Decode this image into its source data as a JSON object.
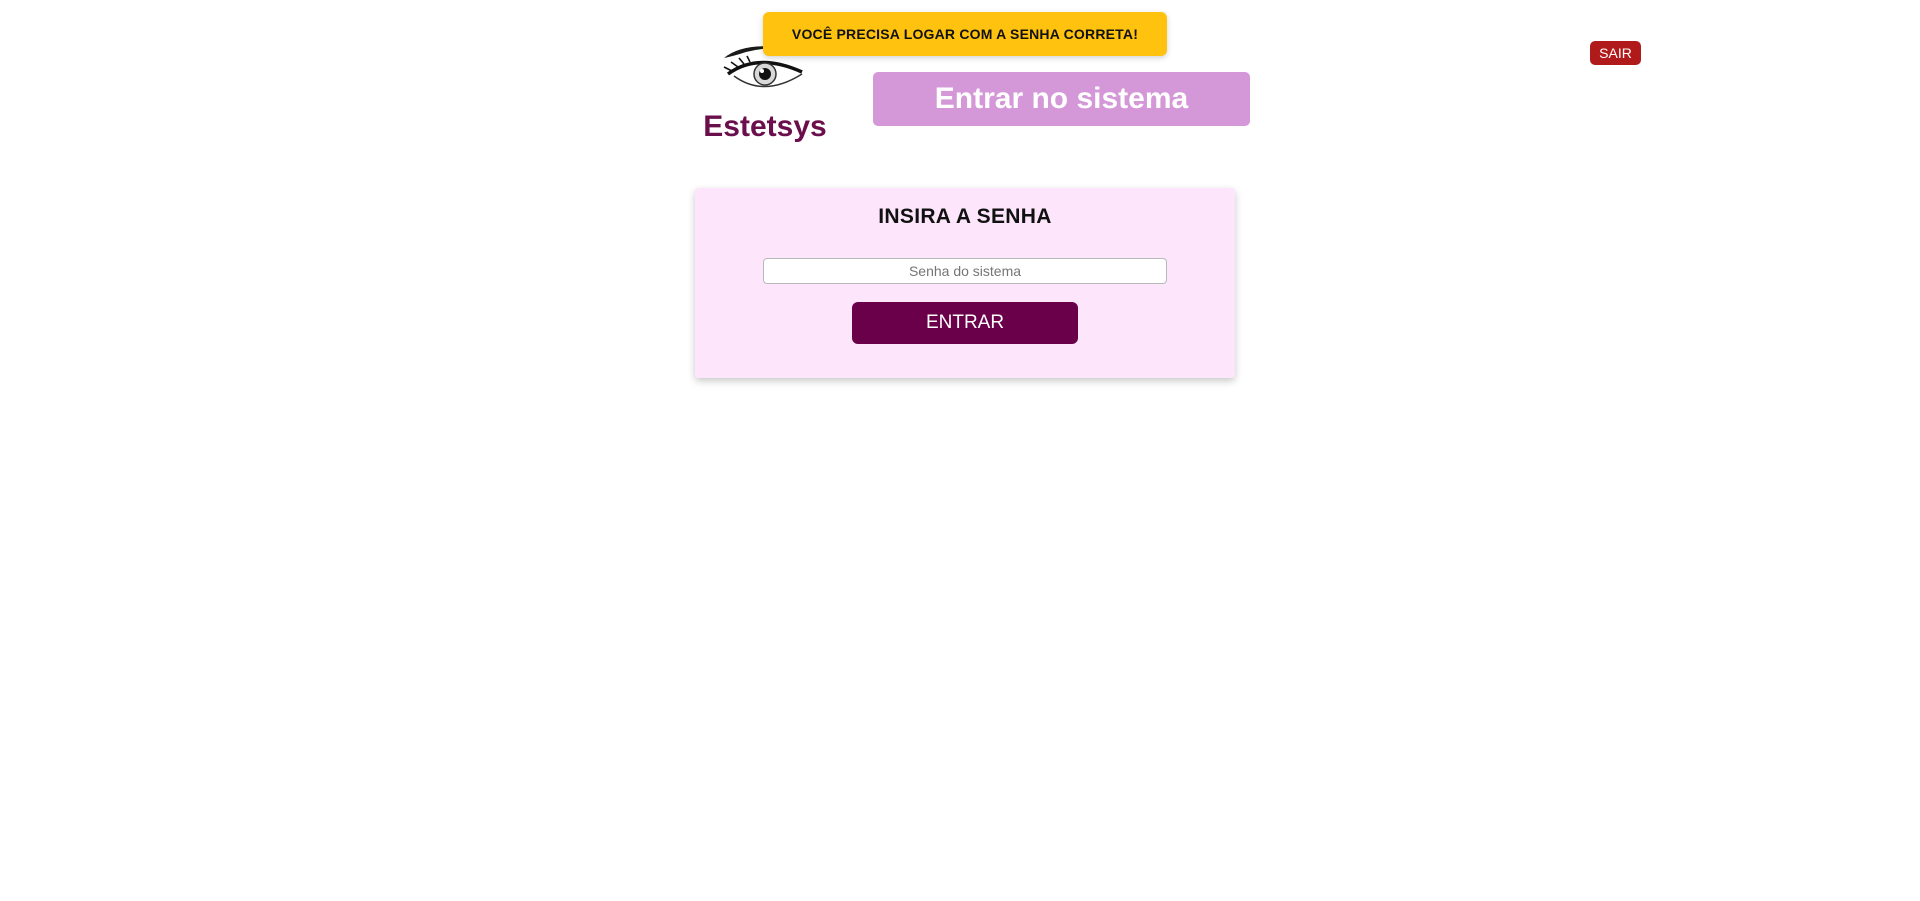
{
  "alert": {
    "message": "VOCÊ PRECISA LOGAR COM A SENHA CORRETA!",
    "color": "#ffc20e"
  },
  "brand": {
    "name": "Estetsys",
    "icon": "eye-logo-icon",
    "color": "#6b0f4c"
  },
  "header": {
    "title": "Entrar no sistema",
    "background": "#d498d8"
  },
  "logout": {
    "label": "SAIR",
    "color": "#b01a1a"
  },
  "login_card": {
    "title": "INSIRA A SENHA",
    "password_value": "",
    "password_placeholder": "Senha do sistema",
    "submit_label": "ENTRAR",
    "background": "#fde6fb",
    "button_color": "#690049"
  }
}
